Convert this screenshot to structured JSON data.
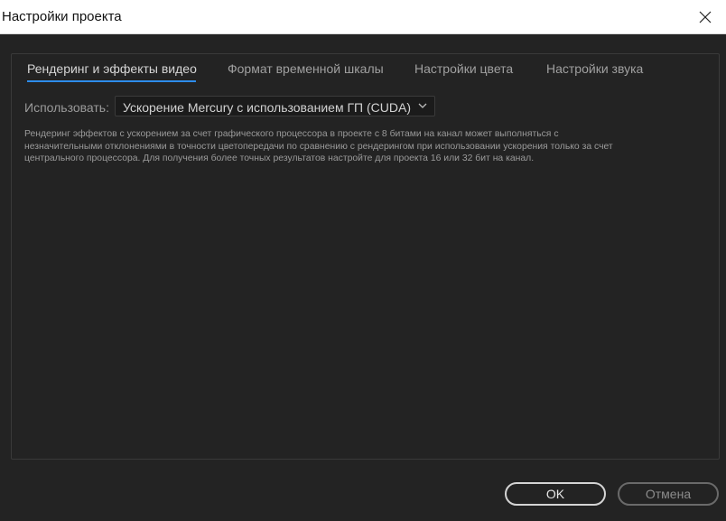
{
  "window": {
    "title": "Настройки проекта",
    "close_icon": "close-icon"
  },
  "tabs": [
    {
      "label": "Рендеринг и эффекты видео",
      "active": true
    },
    {
      "label": "Формат временной шкалы",
      "active": false
    },
    {
      "label": "Настройки цвета",
      "active": false
    },
    {
      "label": "Настройки звука",
      "active": false
    }
  ],
  "renderer": {
    "label": "Использовать:",
    "selected": "Ускорение Mercury с использованием ГП (CUDA)",
    "chevron_icon": "chevron-down-icon"
  },
  "info": {
    "lines": [
      "Рендеринг эффектов с ускорением за счет графического процессора в проекте с 8 битами на канал может выполняться с",
      "незначительными отклонениями в точности цветопередачи по сравнению с рендерингом при использовании ускорения только за счет",
      "центрального процессора. Для получения более точных результатов настройте для проекта 16 или 32 бит на канал."
    ]
  },
  "buttons": {
    "ok": "OK",
    "cancel": "Отмена"
  },
  "colors": {
    "background": "#232323",
    "accent": "#2d8ceb",
    "titlebar": "#ffffff"
  }
}
